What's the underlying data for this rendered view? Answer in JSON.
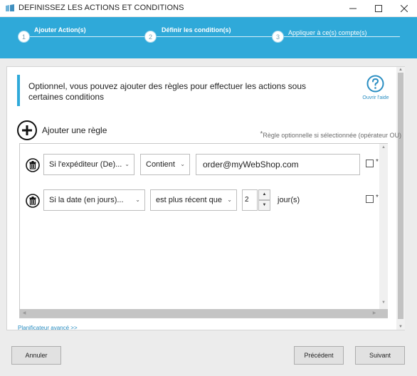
{
  "window": {
    "title": "DEFINISSEZ LES ACTIONS ET CONDITIONS",
    "minimize_glyph": "—",
    "maximize_glyph": "☐",
    "close_glyph": "✕"
  },
  "wizard": {
    "steps": [
      {
        "number": "1",
        "label": "Ajouter Action(s)",
        "active": true
      },
      {
        "number": "2",
        "label": "Définir les condition(s)",
        "active": true
      },
      {
        "number": "3",
        "label": "Appliquer à ce(s) compte(s)",
        "active": false
      }
    ],
    "accent_color": "#2fa9d9"
  },
  "info": {
    "text": "Optionnel, vous pouvez ajouter des règles pour effectuer les actions sous certaines conditions"
  },
  "help": {
    "label": "Ouvrir l'aide"
  },
  "add_rule": {
    "label": "Ajouter une règle",
    "hint_star": "*",
    "hint": "Règle optionnelle si sélectionnée (opérateur OU)"
  },
  "rules": [
    {
      "field": "Si l'expéditeur (De)...",
      "operator": "Contient",
      "value": "order@myWebShop.com",
      "optional_checked": false,
      "star": "*"
    },
    {
      "field": "Si la date (en jours)...",
      "operator": "est plus récent que",
      "value": "2",
      "unit": "jour(s)",
      "optional_checked": false,
      "star": "*"
    }
  ],
  "advanced_link": "Planificateur avancé >>",
  "footer": {
    "cancel": "Annuler",
    "previous": "Précédent",
    "next": "Suivant"
  }
}
